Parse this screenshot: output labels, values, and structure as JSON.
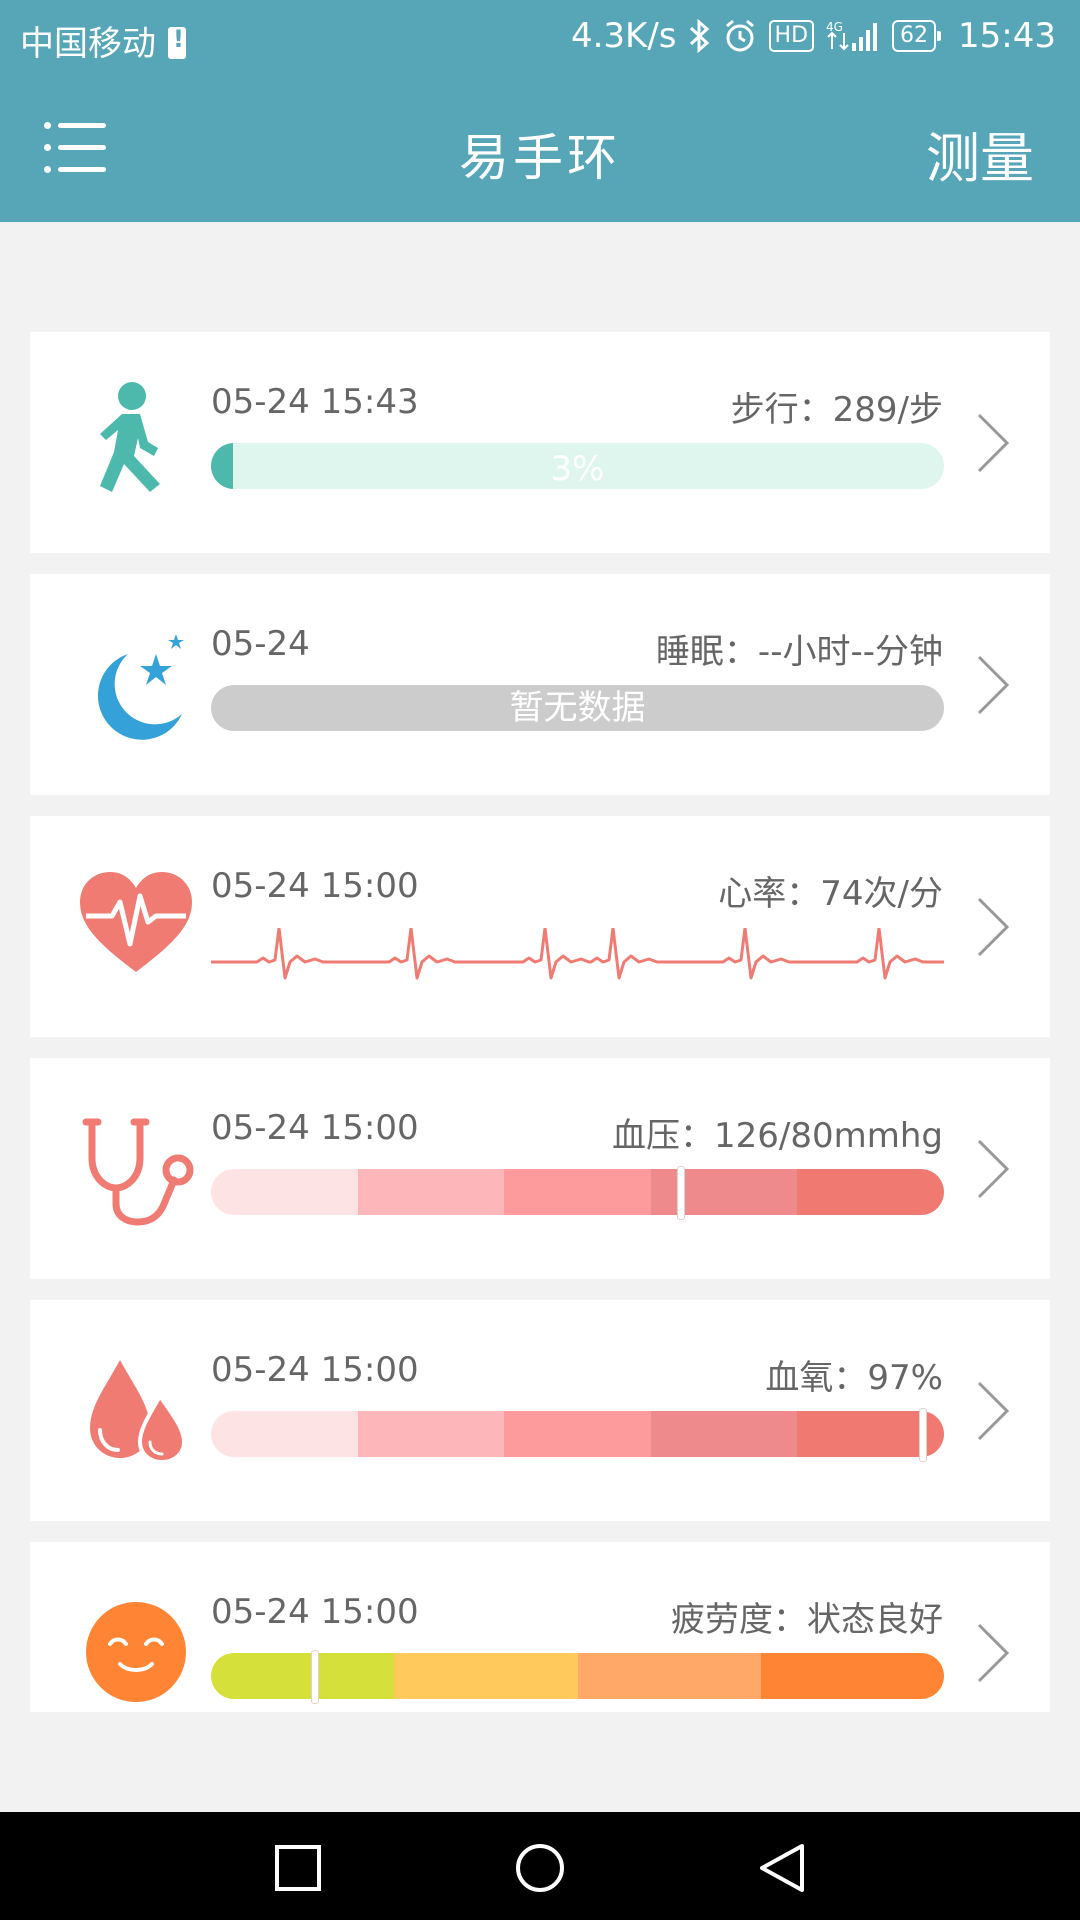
{
  "status_bar": {
    "carrier": "中国移动",
    "speed": "4.3K/s",
    "hd": "HD",
    "network": "4G",
    "battery": "62",
    "time": "15:43"
  },
  "app_bar": {
    "title": "易手环",
    "measure": "测量"
  },
  "cards": {
    "steps": {
      "time": "05-24 15:43",
      "label": "步行：289/步",
      "progress_label": "3%",
      "progress": 0.03,
      "color": "#4cb9ac"
    },
    "sleep": {
      "time": "05-24",
      "label": "睡眠：--小时--分钟",
      "no_data": "暂无数据"
    },
    "heart_rate": {
      "time": "05-24 15:00",
      "label": "心率：74次/分",
      "color": "#f07b73"
    },
    "blood_pressure": {
      "time": "05-24 15:00",
      "label": "血压：126/80mmhg",
      "marker_position": 0.64
    },
    "blood_oxygen": {
      "time": "05-24 15:00",
      "label": "血氧：97%",
      "marker_position": 0.97
    },
    "fatigue": {
      "time": "05-24 15:00",
      "label": "疲劳度：状态良好",
      "marker_position": 0.14
    }
  },
  "colors": {
    "primary": "#56a6b8",
    "red_scale": [
      "#fde3e4",
      "#fdb7ba",
      "#fc9a9c",
      "#ef8a8c",
      "#f07a72"
    ],
    "fatigue_scale": [
      "#d5e03a",
      "#ffc95b",
      "#ffa868",
      "#ff8535"
    ]
  }
}
